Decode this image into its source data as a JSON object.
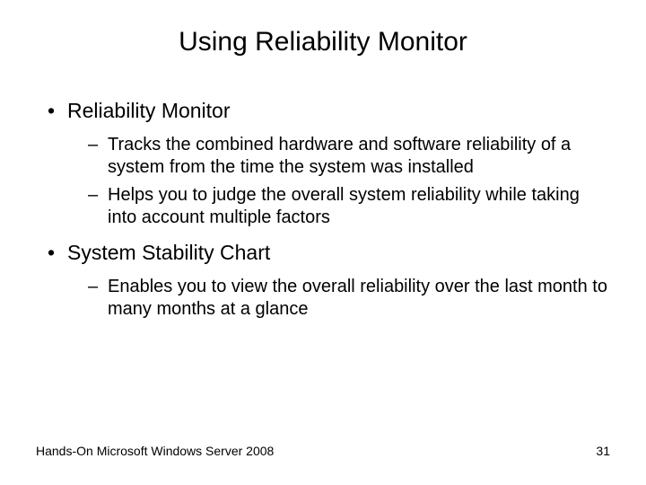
{
  "title": "Using Reliability Monitor",
  "bullets": {
    "item1": {
      "label": "Reliability Monitor",
      "sub1": "Tracks the combined hardware and software reliability of a system from the time the system was installed",
      "sub2": "Helps you to judge the overall system reliability while taking into account multiple factors"
    },
    "item2": {
      "label": "System Stability Chart",
      "sub1": "Enables you to view the overall reliability over the last month to many months at a glance"
    }
  },
  "footer": {
    "source": "Hands-On Microsoft Windows Server 2008",
    "page": "31"
  }
}
